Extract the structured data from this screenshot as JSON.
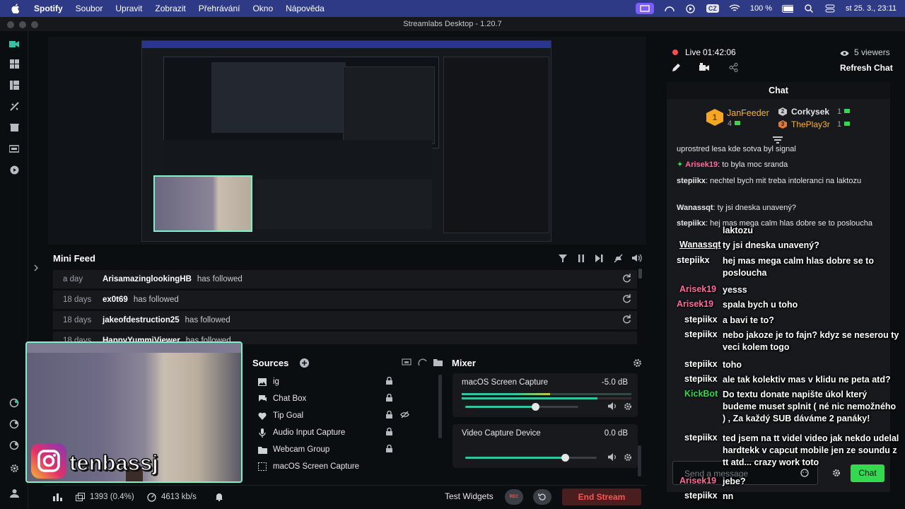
{
  "menubar": {
    "items": [
      "Spotify",
      "Soubor",
      "Upravit",
      "Zobrazit",
      "Přehrávání",
      "Okno",
      "Nápověda"
    ],
    "battery": "100 %",
    "keyboard": "CZ",
    "clock": "st 25. 3.,  23:11"
  },
  "window": {
    "title": "Streamlabs Desktop - 1.20.7"
  },
  "minifeed": {
    "title": "Mini Feed",
    "rows": [
      {
        "ago": "a day",
        "name": "ArisamazinglookingHB",
        "action": "has followed"
      },
      {
        "ago": "18 days",
        "name": "ex0t69",
        "action": "has followed"
      },
      {
        "ago": "18 days",
        "name": "jakeofdestruction25",
        "action": "has followed"
      },
      {
        "ago": "18 days",
        "name": "HappyYummiViewer",
        "action": "has followed"
      }
    ]
  },
  "sources": {
    "title": "Sources",
    "items": [
      {
        "label": "ig",
        "icon": "image-icon"
      },
      {
        "label": "Chat Box",
        "icon": "chat-icon"
      },
      {
        "label": "Tip Goal",
        "icon": "heart-icon"
      },
      {
        "label": "Audio Input Capture",
        "icon": "mic-icon"
      },
      {
        "label": "Webcam Group",
        "icon": "folder-icon"
      },
      {
        "label": "macOS Screen Capture",
        "icon": "screen-capture-icon"
      }
    ]
  },
  "mixer": {
    "title": "Mixer",
    "channels": [
      {
        "name": "macOS Screen Capture",
        "db": "-5.0 dB",
        "level": 0.62
      },
      {
        "name": "Video Capture Device",
        "db": "0.0 dB",
        "level": 0.76
      }
    ]
  },
  "bottombar": {
    "dropped": "1393 (0.4%)",
    "bitrate": "4613 kb/s",
    "test_widgets": "Test Widgets",
    "rec": "REC",
    "end_stream": "End Stream"
  },
  "webcam": {
    "handle": "tenbassj"
  },
  "live": {
    "status": "Live",
    "time": "01:42:06",
    "viewers": "5 viewers",
    "refresh": "Refresh Chat"
  },
  "chat": {
    "title": "Chat",
    "leaders": [
      {
        "rank": "1",
        "name": "JanFeeder",
        "count": "4"
      },
      {
        "rank": "2",
        "name": "Corkysek",
        "count": "1"
      },
      {
        "rank": "3",
        "name": "ThePlay3r",
        "count": "1"
      }
    ],
    "lines": [
      {
        "nick": "",
        "text": "uprostred lesa kde sotva byl signal",
        "color": "#e6e6e6"
      },
      {
        "nick": "Arisek19",
        "text": ": to byla moc sranda",
        "color": "#ff6b9a"
      },
      {
        "nick": "stepiikx",
        "text": ": nechtel bych mit treba intoleranci na laktozu",
        "color": "#e6e6e6"
      },
      {
        "nick": "Wanassqt",
        "text": ": ty jsi dneska unavený?",
        "color": "#e6e6e6"
      },
      {
        "nick": "stepiikx",
        "text": ": hej mas mega calm hlas dobre se to poslouchа",
        "color": "#e6e6e6"
      }
    ],
    "input_placeholder": "Send a message",
    "send": "Chat"
  },
  "overlay": {
    "lines": [
      {
        "nick": "",
        "text": "laktozu"
      },
      {
        "nick": "Wanassqt",
        "text": "ty jsi dneska unavený?"
      },
      {
        "nick": "stepiikx",
        "text": "hej mas mega calm hlas dobre se to poslouchа"
      },
      {
        "nick": "Arisek19",
        "text": "yesss"
      },
      {
        "nick": "Arisek19",
        "text": "spala bych u toho"
      },
      {
        "nick": "stepiikx",
        "text": "a bavi te to?"
      },
      {
        "nick": "stepiikx",
        "text": "nebo jakoze je to fajn? kdyz se neserou ty veci kolem togo"
      },
      {
        "nick": "stepiikx",
        "text": "toho"
      },
      {
        "nick": "stepiikx",
        "text": "ale tak kolektiv mas v klidu ne peta atd?"
      },
      {
        "nick": "KickBot",
        "text": "Do textu donate napište úkol který budeme muset splnit ( né nic nemožného ) , Za každý SUB dáváme 2 panáky!"
      },
      {
        "nick": "stepiikx",
        "text": "ted jsem na tt videl video jak nekdo udelal hardtekk v capcut mobile jen ze soundu z tt atd... crazy work toto"
      },
      {
        "nick": "Arisek19",
        "text": "jebe?"
      },
      {
        "nick": "stepiikx",
        "text": "nn"
      }
    ]
  },
  "colors": {
    "accent": "#31c3a2",
    "live": "#ff4c4c",
    "chat_btn": "#33d94f",
    "nick_pink": "#ff6b9a"
  }
}
